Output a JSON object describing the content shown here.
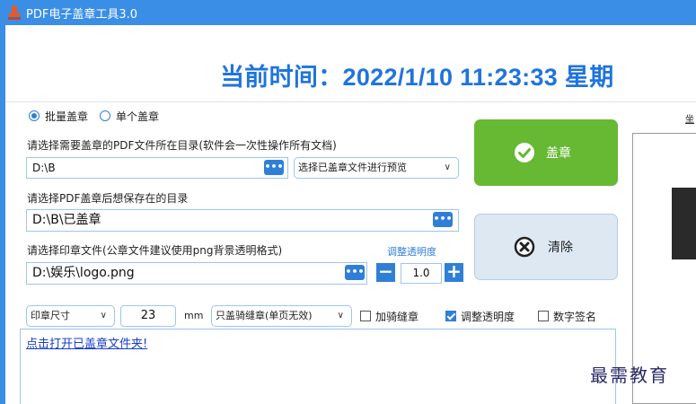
{
  "window": {
    "title": "PDF电子盖章工具3.0"
  },
  "clock": {
    "text": "当前时间：2022/1/10 11:23:33 星期"
  },
  "mode": {
    "batch_label": "批量盖章",
    "single_label": "单个盖章",
    "selected": "batch"
  },
  "source_dir": {
    "label": "请选择需要盖章的PDF文件所在目录(软件会一次性操作所有文档)",
    "value": "D:\\B",
    "browse_label": "•••",
    "preview_select": "选择已盖章文件进行预览"
  },
  "output_dir": {
    "label": "请选择PDF盖章后想保存在的目录",
    "value": "D:\\B\\已盖章",
    "browse_label": "•••"
  },
  "seal_file": {
    "label": "请选择印章文件(公章文件建议使用png背景透明格式)",
    "value": "D:\\娱乐\\logo.png",
    "browse_label": "•••",
    "opacity_link": "调整透明度",
    "opacity_value": "1.0",
    "minus_label": "−",
    "plus_label": "+"
  },
  "options": {
    "size_select": "印章尺寸",
    "size_value": "23",
    "unit": "mm",
    "mode_select": "只盖骑缝章(单页无效)",
    "riding_seal": {
      "label": "加骑缝章",
      "checked": false
    },
    "adjust_opacity": {
      "label": "调整透明度",
      "checked": true
    },
    "digital_sign": {
      "label": "数字签名",
      "checked": false
    }
  },
  "buttons": {
    "stamp_label": "盖章",
    "clear_label": "清除"
  },
  "log": {
    "link_text": "点击打开已盖章文件夹!"
  },
  "side": {
    "partial_label": "坐"
  },
  "watermark": {
    "text": "最需教育"
  },
  "colors": {
    "titlebar": "#3a8ee6",
    "accent_blue": "#2f7fd8",
    "clock_blue": "#1f74dd",
    "stamp_green": "#67b832"
  }
}
